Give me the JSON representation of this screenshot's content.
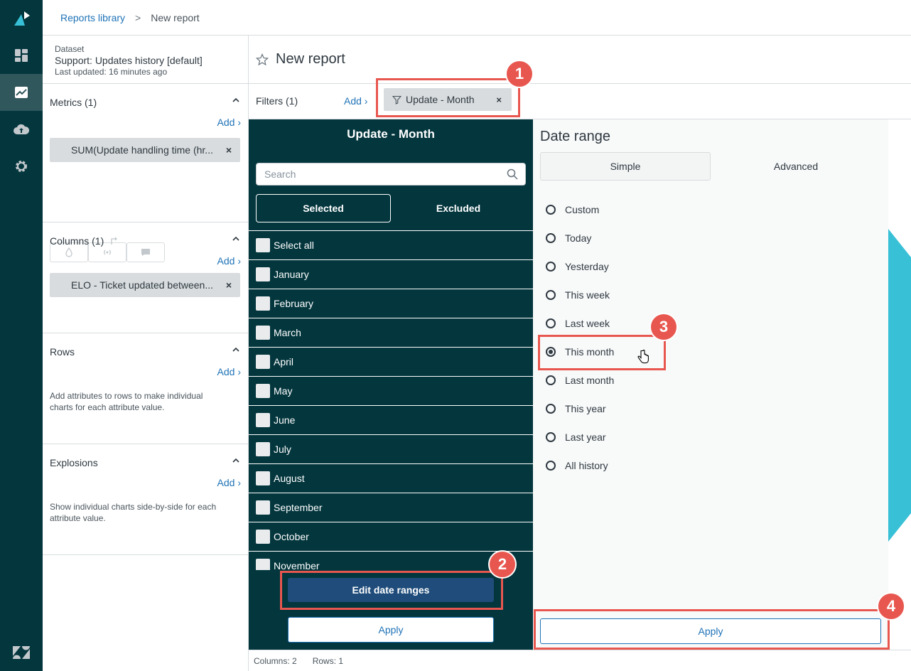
{
  "breadcrumb": {
    "parent": "Reports library",
    "separator": ">",
    "current": "New report"
  },
  "nav": {
    "items": [
      "logo-icon",
      "dashboard-icon",
      "reports-icon",
      "upload-icon",
      "settings-icon",
      "zendesk-icon"
    ]
  },
  "dataset": {
    "label": "Dataset",
    "name": "Support: Updates history [default]",
    "updated": "Last updated: 16 minutes ago"
  },
  "metrics": {
    "title": "Metrics (1)",
    "add": "Add",
    "pill": "SUM(Update handling time (hr...",
    "remove": "×"
  },
  "columns": {
    "title": "Columns (1)",
    "add": "Add",
    "pill": "ELO - Ticket updated between...",
    "remove": "×"
  },
  "rows": {
    "title": "Rows",
    "add": "Add",
    "hint": "Add attributes to rows to make individual charts for each attribute value."
  },
  "explosions": {
    "title": "Explosions",
    "add": "Add",
    "hint": "Show individual charts side-by-side for each attribute value."
  },
  "report": {
    "title": "New report"
  },
  "filters": {
    "label": "Filters (1)",
    "add": "Add",
    "chip": "Update - Month",
    "remove": "×"
  },
  "filter_panel": {
    "title": "Update - Month",
    "search_placeholder": "Search",
    "tab_selected": "Selected",
    "tab_excluded": "Excluded",
    "items": [
      "Select all",
      "January",
      "February",
      "March",
      "April",
      "May",
      "June",
      "July",
      "August",
      "September",
      "October",
      "November"
    ],
    "edit_button": "Edit date ranges",
    "apply_button": "Apply"
  },
  "date_range": {
    "title": "Date range",
    "tab_simple": "Simple",
    "tab_advanced": "Advanced",
    "options": [
      "Custom",
      "Today",
      "Yesterday",
      "This week",
      "Last week",
      "This month",
      "Last month",
      "This year",
      "Last year",
      "All history"
    ],
    "selected": "This month",
    "apply_button": "Apply"
  },
  "status": {
    "columns": "Columns: 2",
    "rows": "Rows: 1"
  },
  "callouts": [
    "1",
    "2",
    "3",
    "4"
  ],
  "colors": {
    "rail": "#03363d",
    "accent": "#1f73b7",
    "callout": "#e8574f",
    "decor": "#37c0d6"
  }
}
